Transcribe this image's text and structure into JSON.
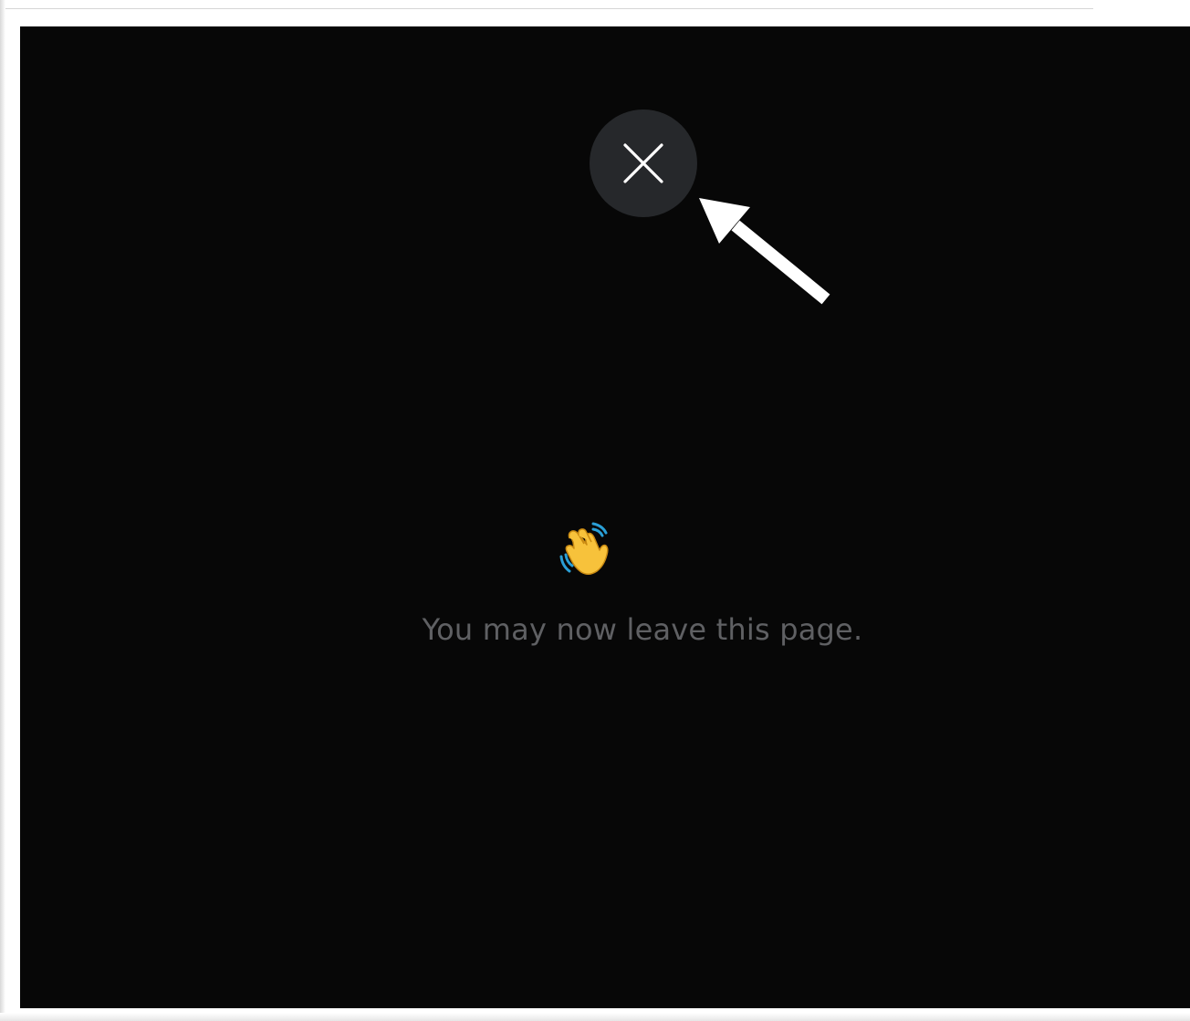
{
  "close_button": {
    "icon": "close-icon",
    "background": "#26282b",
    "icon_color": "#ffffff"
  },
  "message": {
    "icon": "waving-hand-icon",
    "text": "You may now leave this page.",
    "text_color": "#5f6063"
  },
  "annotation": {
    "icon": "pointer-arrow-icon",
    "color": "#ffffff"
  },
  "colors": {
    "screen_background": "#070707",
    "frame_background": "#ffffff"
  }
}
